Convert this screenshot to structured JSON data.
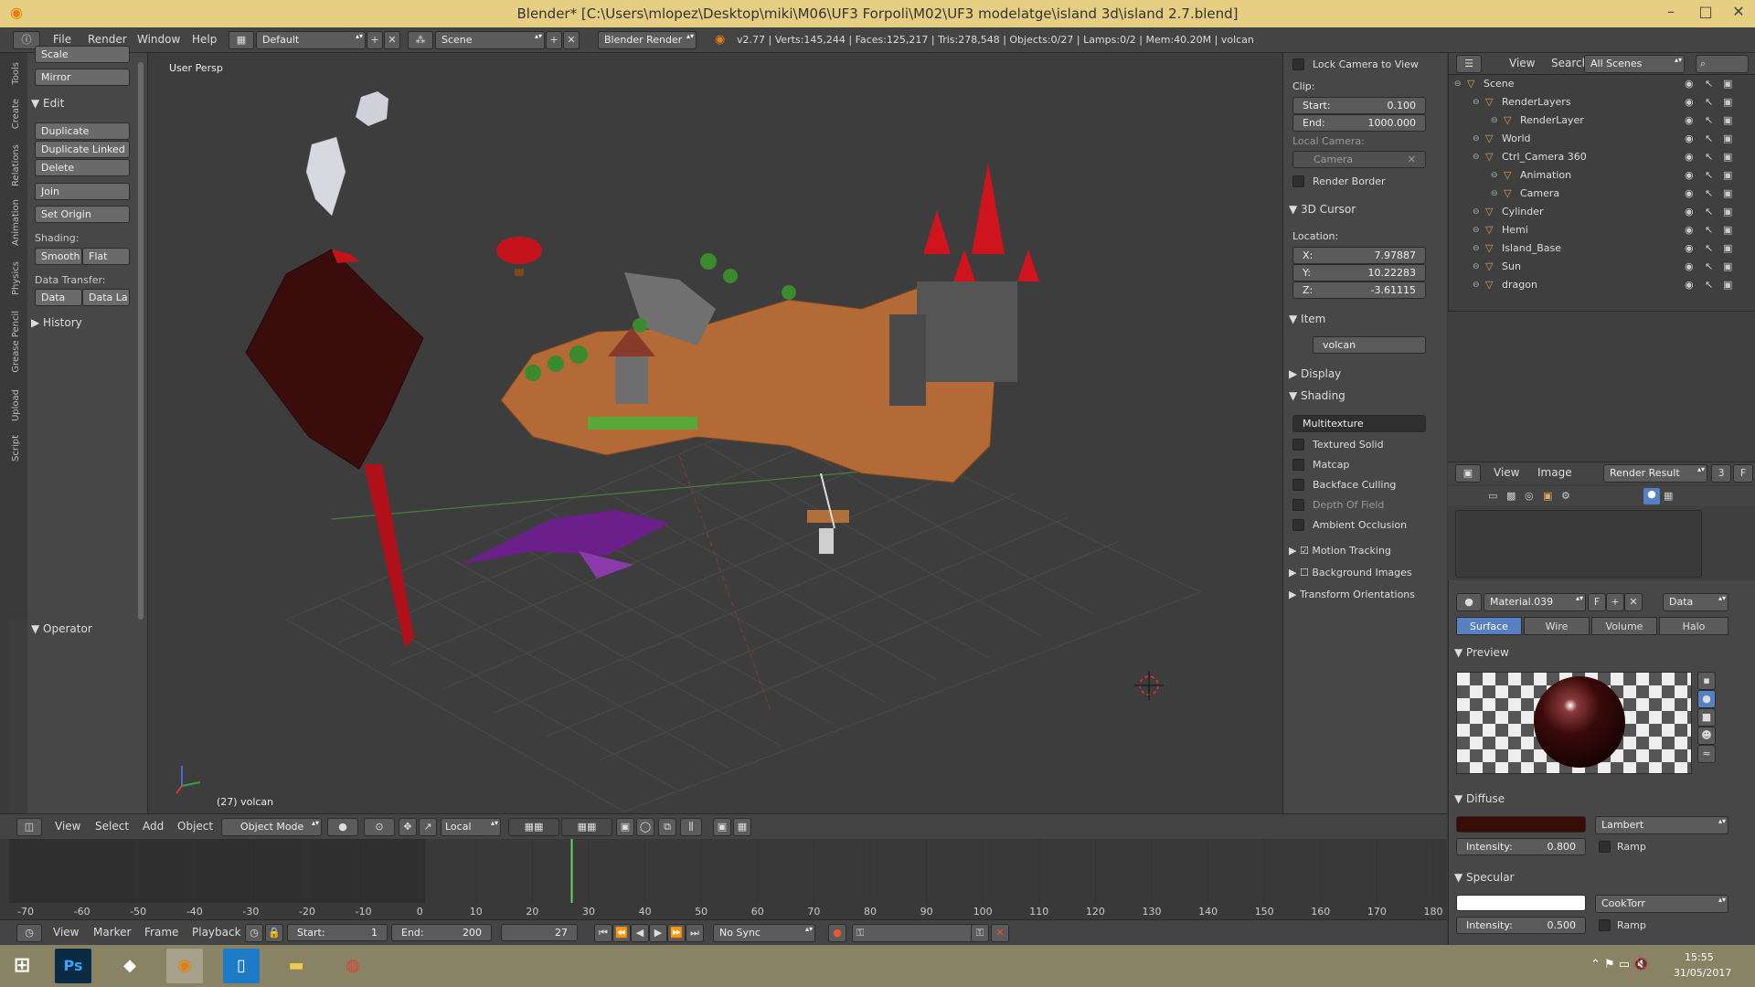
{
  "window": {
    "title": "Blender* [C:\\Users\\mlopez\\Desktop\\miki\\M06\\UF3 Forpoli\\M02\\UF3 modelatge\\island 3d\\island 2.7.blend]",
    "minimize": "–",
    "maximize": "□",
    "close": "✕"
  },
  "info_header": {
    "menus": [
      "File",
      "Render",
      "Window",
      "Help"
    ],
    "layout": "Default",
    "scene": "Scene",
    "engine": "Blender Render",
    "stats": "v2.77 | Verts:145,244 | Faces:125,217 | Tris:278,548 | Objects:0/27 | Lamps:0/2 | Mem:40.20M | volcan"
  },
  "left_tabs": [
    "Tools",
    "Create",
    "Relations",
    "Animation",
    "Physics",
    "Grease Pencil",
    "Upload",
    "Script"
  ],
  "toolshelf": {
    "scale": "Scale",
    "mirror": "Mirror",
    "edit_header": "Edit",
    "duplicate": "Duplicate",
    "duplicate_linked": "Duplicate Linked",
    "delete": "Delete",
    "join": "Join",
    "set_origin": "Set Origin",
    "shading_label": "Shading:",
    "smooth": "Smooth",
    "flat": "Flat",
    "data_transfer_label": "Data Transfer:",
    "data": "Data",
    "data_la": "Data La",
    "history_header": "History",
    "operator_header": "Operator"
  },
  "viewport": {
    "label": "User Persp",
    "object_label": "(27) volcan"
  },
  "npanel": {
    "lock_camera": "Lock Camera to View",
    "clip_label": "Clip:",
    "clip_start_label": "Start:",
    "clip_start": "0.100",
    "clip_end_label": "End:",
    "clip_end": "1000.000",
    "local_camera_label": "Local Camera:",
    "local_camera": "Camera",
    "render_border": "Render Border",
    "cursor_header": "3D Cursor",
    "location_label": "Location:",
    "x_label": "X:",
    "x": "7.97887",
    "y_label": "Y:",
    "y": "10.22283",
    "z_label": "Z:",
    "z": "-3.61115",
    "item_header": "Item",
    "item_name": "volcan",
    "display_header": "Display",
    "shading_header": "Shading",
    "shading_mode": "Multitexture",
    "textured_solid": "Textured Solid",
    "matcap": "Matcap",
    "backface_culling": "Backface Culling",
    "depth_of_field": "Depth Of Field",
    "ambient_occlusion": "Ambient Occlusion",
    "motion_tracking": "Motion Tracking",
    "background_images": "Background Images",
    "transform_orientations": "Transform Orientations"
  },
  "outliner": {
    "view": "View",
    "search": "Search",
    "filter": "All Scenes",
    "items": [
      {
        "label": "Scene",
        "indent": 0
      },
      {
        "label": "RenderLayers",
        "indent": 1
      },
      {
        "label": "RenderLayer",
        "indent": 2
      },
      {
        "label": "World",
        "indent": 1
      },
      {
        "label": "Ctrl_Camera 360",
        "indent": 1
      },
      {
        "label": "Animation",
        "indent": 2
      },
      {
        "label": "Camera",
        "indent": 2
      },
      {
        "label": "Cylinder",
        "indent": 1
      },
      {
        "label": "Hemi",
        "indent": 1
      },
      {
        "label": "Island_Base",
        "indent": 1
      },
      {
        "label": "Sun",
        "indent": 1
      },
      {
        "label": "dragon",
        "indent": 1
      }
    ]
  },
  "image_editor": {
    "view": "View",
    "image": "Image",
    "render_result": "Render Result",
    "slot": "3",
    "f": "F"
  },
  "material": {
    "name": "Material.039",
    "f": "F",
    "data_dropdown": "Data",
    "tabs": [
      "Surface",
      "Wire",
      "Volume",
      "Halo"
    ],
    "preview_header": "Preview",
    "diffuse_header": "Diffuse",
    "diffuse_color": "#3a0c08",
    "diffuse_shader": "Lambert",
    "diffuse_intensity_label": "Intensity:",
    "diffuse_intensity": "0.800",
    "ramp": "Ramp",
    "specular_header": "Specular",
    "specular_shader": "CookTorr",
    "specular_intensity_label": "Intensity:",
    "specular_intensity": "0.500"
  },
  "v3d_header": {
    "menus": [
      "View",
      "Select",
      "Add",
      "Object"
    ],
    "mode": "Object Mode",
    "orientation": "Local"
  },
  "timeline": {
    "ticks": [
      "-70",
      "-60",
      "-50",
      "-40",
      "-30",
      "-20",
      "-10",
      "0",
      "10",
      "20",
      "30",
      "40",
      "50",
      "60",
      "70",
      "80",
      "90",
      "100",
      "110",
      "120",
      "130",
      "140",
      "150",
      "160",
      "170",
      "180"
    ],
    "current_frame": 27
  },
  "timeline_header": {
    "menus": [
      "View",
      "Marker",
      "Frame",
      "Playback"
    ],
    "start_label": "Start:",
    "start": "1",
    "end_label": "End:",
    "end": "200",
    "frame": "27",
    "sync": "No Sync"
  },
  "taskbar": {
    "time": "15:55",
    "date": "31/05/2017",
    "apps": [
      "Ps",
      "Unity",
      "Blender",
      "Notes",
      "Explorer",
      "Chrome"
    ]
  }
}
